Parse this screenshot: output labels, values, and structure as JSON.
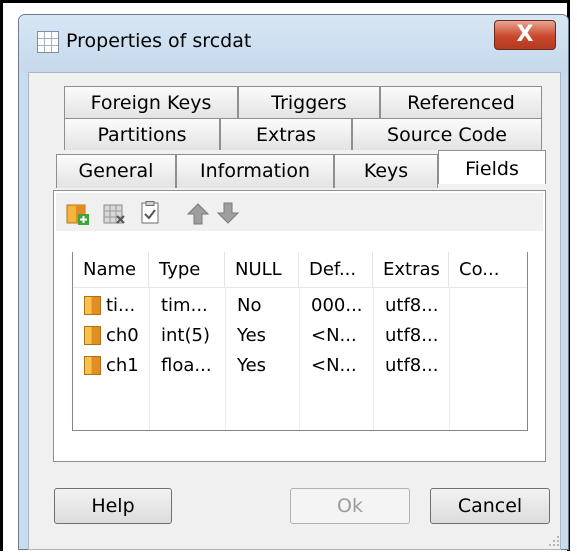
{
  "window": {
    "title": "Properties of srcdat",
    "close_label": "X"
  },
  "tabs": {
    "row1": [
      "Foreign Keys",
      "Triggers",
      "Referenced"
    ],
    "row2": [
      "Partitions",
      "Extras",
      "Source Code"
    ],
    "row3": [
      "General",
      "Information",
      "Keys",
      "Fields"
    ],
    "active": "Fields"
  },
  "toolbar": {
    "icons": [
      "add-field-icon",
      "delete-field-icon",
      "properties-icon",
      "move-up-icon",
      "move-down-icon"
    ]
  },
  "fields_table": {
    "columns": [
      "Name",
      "Type",
      "NULL",
      "Def...",
      "Extras",
      "Co..."
    ],
    "rows": [
      [
        "ti...",
        "tim...",
        "No",
        "000...",
        "utf8...",
        ""
      ],
      [
        "ch0",
        "int(5)",
        "Yes",
        "<N...",
        "utf8...",
        ""
      ],
      [
        "ch1",
        "floa...",
        "Yes",
        "<N...",
        "utf8...",
        ""
      ]
    ]
  },
  "buttons": {
    "help": "Help",
    "ok": "Ok",
    "cancel": "Cancel"
  }
}
